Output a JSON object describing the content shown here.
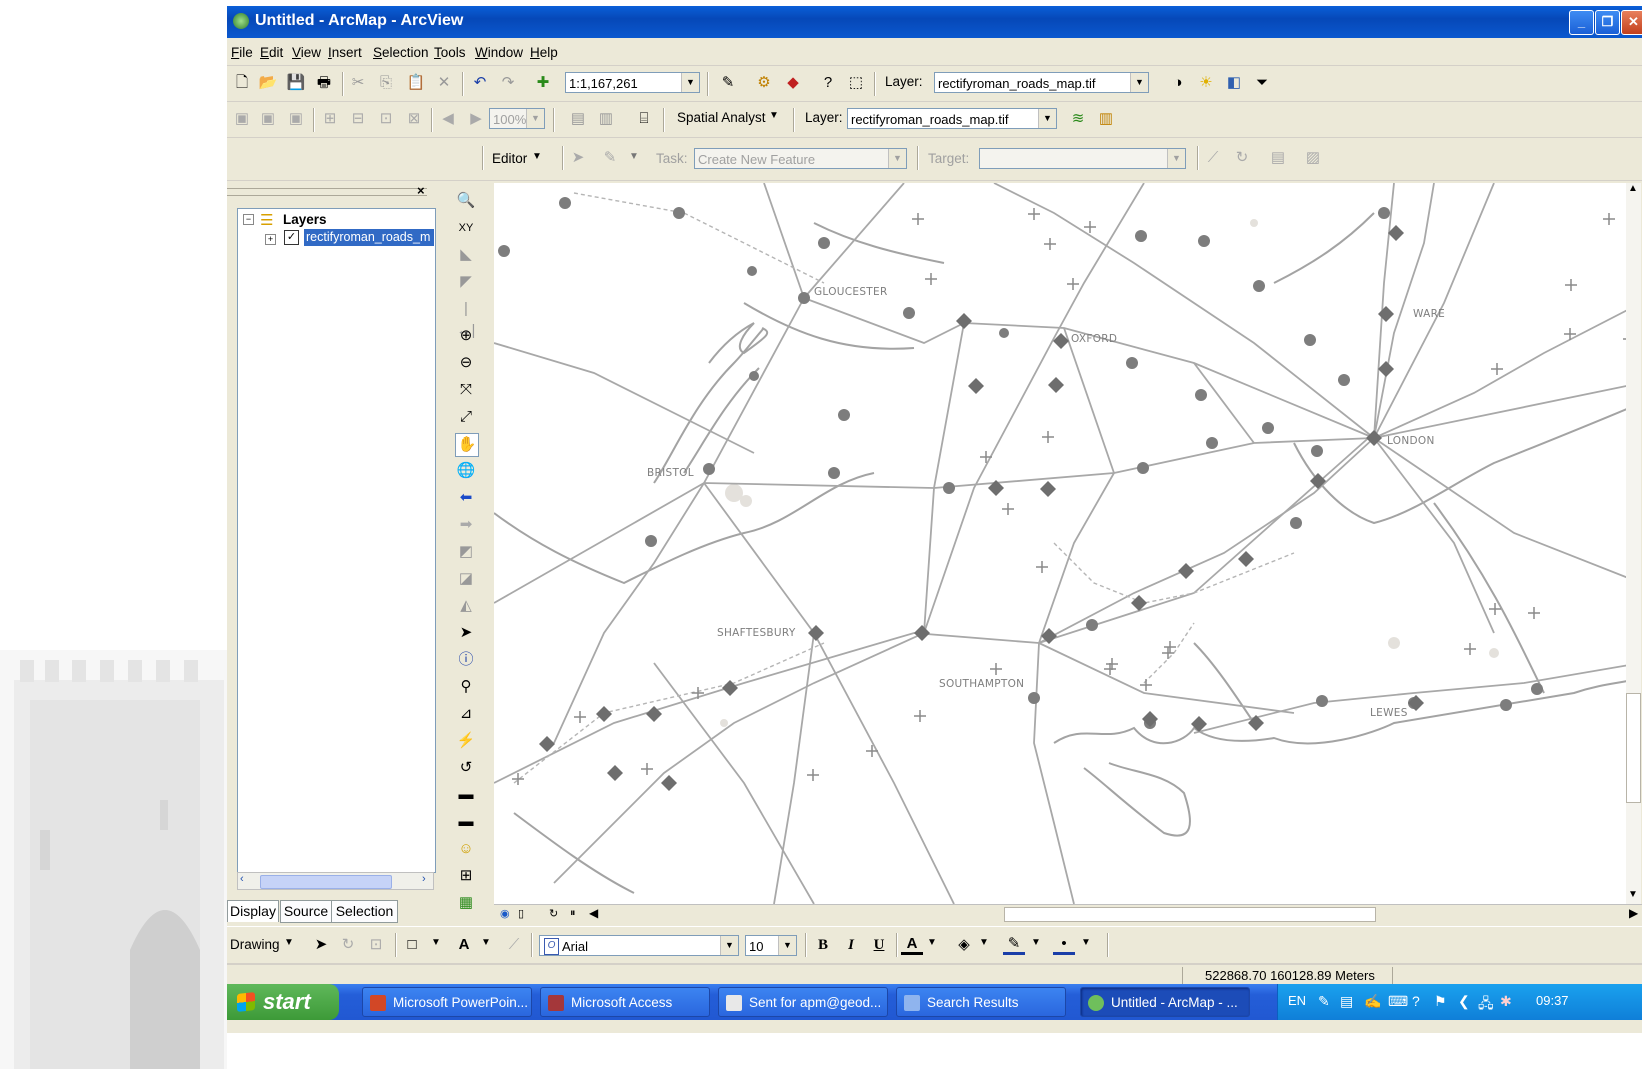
{
  "window": {
    "title": "Untitled - ArcMap - ArcView",
    "controls": [
      "minimize-icon",
      "restore-icon",
      "close-icon"
    ]
  },
  "menu": {
    "items": [
      "File",
      "Edit",
      "View",
      "Insert",
      "Selection",
      "Tools",
      "Window",
      "Help"
    ]
  },
  "standard_toolbar": {
    "scale_value": "1:1,167,261",
    "layer_label": "Layer:",
    "layer_value": "rectifyroman_roads_map.tif",
    "icons": [
      "new-document-icon",
      "open-icon",
      "save-icon",
      "print-icon",
      "cut-icon",
      "copy-icon",
      "paste-icon",
      "delete-icon",
      "undo-icon",
      "redo-icon",
      "add-data-icon",
      "editor-toolbar-icon",
      "arctoolbox-icon",
      "arccatalog-icon",
      "whats-this-icon",
      "model-icon",
      "contrast-icon",
      "brightness-icon",
      "transparency-icon",
      "toolbar-options-icon"
    ]
  },
  "georef_toolbar": {
    "zoom_value": "100%",
    "spatial_analyst_label": "Spatial Analyst",
    "layer_label": "Layer:",
    "layer_value": "rectifyroman_roads_map.tif"
  },
  "editor_toolbar": {
    "editor_label": "Editor",
    "task_label": "Task:",
    "task_value": "Create New Feature",
    "target_label": "Target:",
    "target_value": ""
  },
  "toc": {
    "root_label": "Layers",
    "layer_name": "rectifyroman_roads_m",
    "layer_checked": true,
    "tabs": [
      "Display",
      "Source",
      "Selection"
    ]
  },
  "map": {
    "place_labels": [
      "GLOUCESTER",
      "OXFORD",
      "WARE",
      "LONDON",
      "BRISTOL",
      "SHAFTESBURY",
      "SOUTHAMPTON",
      "LEWES"
    ]
  },
  "drawing_toolbar": {
    "drawing_label": "Drawing",
    "font_name": "Arial",
    "font_size": "10",
    "bold_label": "B",
    "italic_label": "I",
    "underline_label": "U",
    "font_color_label": "A"
  },
  "status": {
    "coordinates": "522868.70  160128.89 Meters"
  },
  "taskbar": {
    "start_label": "start",
    "tasks": [
      "Microsoft PowerPoin...",
      "Microsoft Access",
      "Sent for apm@geod...",
      "Search Results",
      "Untitled - ArcMap - ..."
    ],
    "language": "EN",
    "clock": "09:37"
  }
}
